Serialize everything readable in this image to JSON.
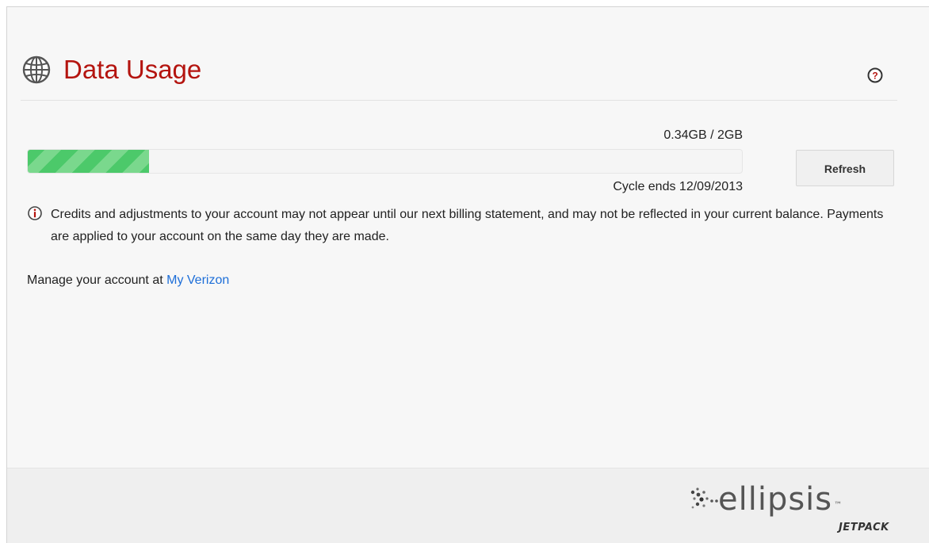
{
  "header": {
    "title": "Data Usage"
  },
  "usage": {
    "summary": "0.34GB / 2GB",
    "used_fraction": 0.17,
    "cycle_end": "Cycle ends 12/09/2013"
  },
  "actions": {
    "refresh_label": "Refresh"
  },
  "notice": {
    "text": "Credits and adjustments to your account may not appear until our next billing statement, and may not be reflected in your current balance. Payments are applied to your account on the same day they are made."
  },
  "manage": {
    "prefix": "Manage your account at ",
    "link_label": "My Verizon"
  },
  "footer": {
    "brand_word": "ellipsis",
    "brand_tm": "™",
    "brand_sub": "JETPACK"
  },
  "colors": {
    "title": "#b4140f",
    "progress": "#4cc96a",
    "link": "#1d6ed8"
  },
  "icons": {
    "globe": "globe-icon",
    "help": "help-icon",
    "info": "info-icon",
    "logo": "ellipsis-dots-icon"
  }
}
